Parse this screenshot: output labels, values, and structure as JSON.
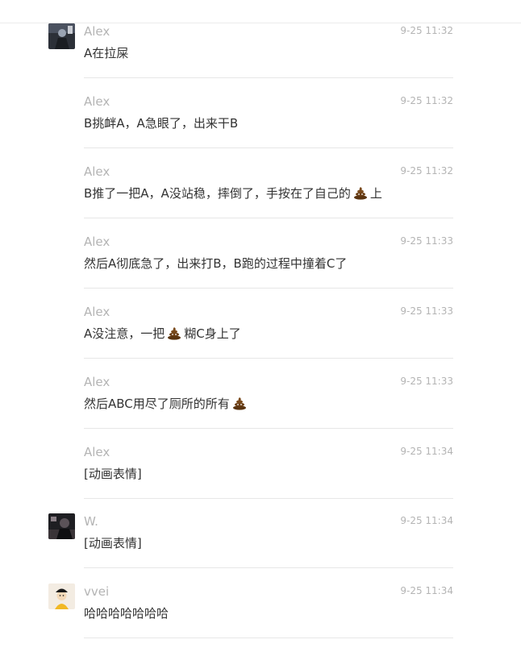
{
  "messages": [
    {
      "sender": "Alex",
      "time": "9-25 11:32",
      "text_before": "A在拉屎",
      "text_after": ""
    },
    {
      "sender": "Alex",
      "time": "9-25 11:32",
      "text_before": "B挑衅A，A急眼了，出来干B",
      "text_after": ""
    },
    {
      "sender": "Alex",
      "time": "9-25 11:32",
      "text_before": "B推了一把A，A没站稳，摔倒了，手按在了自己的",
      "text_after": "上"
    },
    {
      "sender": "Alex",
      "time": "9-25 11:33",
      "text_before": "然后A彻底急了，出来打B，B跑的过程中撞着C了",
      "text_after": ""
    },
    {
      "sender": "Alex",
      "time": "9-25 11:33",
      "text_before": "A没注意，一把",
      "text_after": "糊C身上了"
    },
    {
      "sender": "Alex",
      "time": "9-25 11:33",
      "text_before": "然后ABC用尽了厕所的所有",
      "text_after": ""
    },
    {
      "sender": "Alex",
      "time": "9-25 11:34",
      "text_before": "[动画表情]",
      "text_after": ""
    },
    {
      "sender": "W.",
      "time": "9-25 11:34",
      "text_before": "[动画表情]",
      "text_after": ""
    },
    {
      "sender": "vvei",
      "time": "9-25 11:34",
      "text_before": "哈哈哈哈哈哈哈",
      "text_after": ""
    }
  ],
  "icons": {
    "emoji": "poop-emoji-icon",
    "avatar_alex": "avatar-dark-figure",
    "avatar_w": "avatar-dark-silhouette",
    "avatar_vvei": "avatar-yellow-character"
  },
  "colors": {
    "meta_text": "#b4b4b4",
    "body_text": "#333333",
    "divider": "#e7e7e7"
  }
}
